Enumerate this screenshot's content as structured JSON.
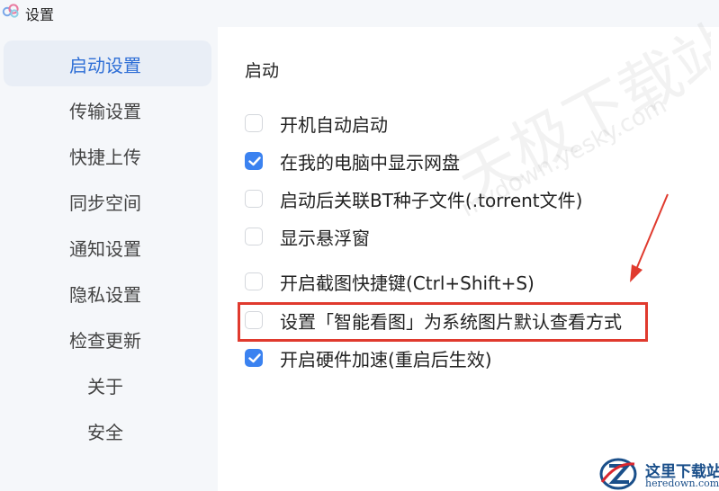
{
  "window": {
    "title": "设置",
    "icon": "cloud-drive-logo-icon"
  },
  "sidebar": {
    "items": [
      {
        "label": "启动设置",
        "active": true
      },
      {
        "label": "传输设置",
        "active": false
      },
      {
        "label": "快捷上传",
        "active": false
      },
      {
        "label": "同步空间",
        "active": false
      },
      {
        "label": "通知设置",
        "active": false
      },
      {
        "label": "隐私设置",
        "active": false
      },
      {
        "label": "检查更新",
        "active": false
      },
      {
        "label": "关于",
        "active": false
      },
      {
        "label": "安全",
        "active": false
      }
    ]
  },
  "main": {
    "section_title": "启动",
    "options": [
      {
        "label": "开机自动启动",
        "checked": false
      },
      {
        "label": "在我的电脑中显示网盘",
        "checked": true
      },
      {
        "label": "启动后关联BT种子文件(.torrent文件)",
        "checked": false
      },
      {
        "label": "显示悬浮窗",
        "checked": false
      },
      {
        "label": "开启截图快捷键(Ctrl+Shift+S)",
        "checked": false
      },
      {
        "label": "设置「智能看图」为系统图片默认查看方式",
        "checked": false
      },
      {
        "label": "开启硬件加速(重启后生效)",
        "checked": true
      }
    ]
  },
  "annotations": {
    "highlight_color": "#e03a2e",
    "arrow_color": "#e03a2e"
  },
  "watermarks": {
    "center_text": "天极下载站",
    "center_url": "mydown.yesky.com",
    "corner_title": "这里下载站",
    "corner_url": "heredown.com"
  },
  "colors": {
    "accent": "#3b82f0",
    "active_nav_text": "#2f6fd6",
    "sidebar_bg": "#f5f7fa"
  }
}
